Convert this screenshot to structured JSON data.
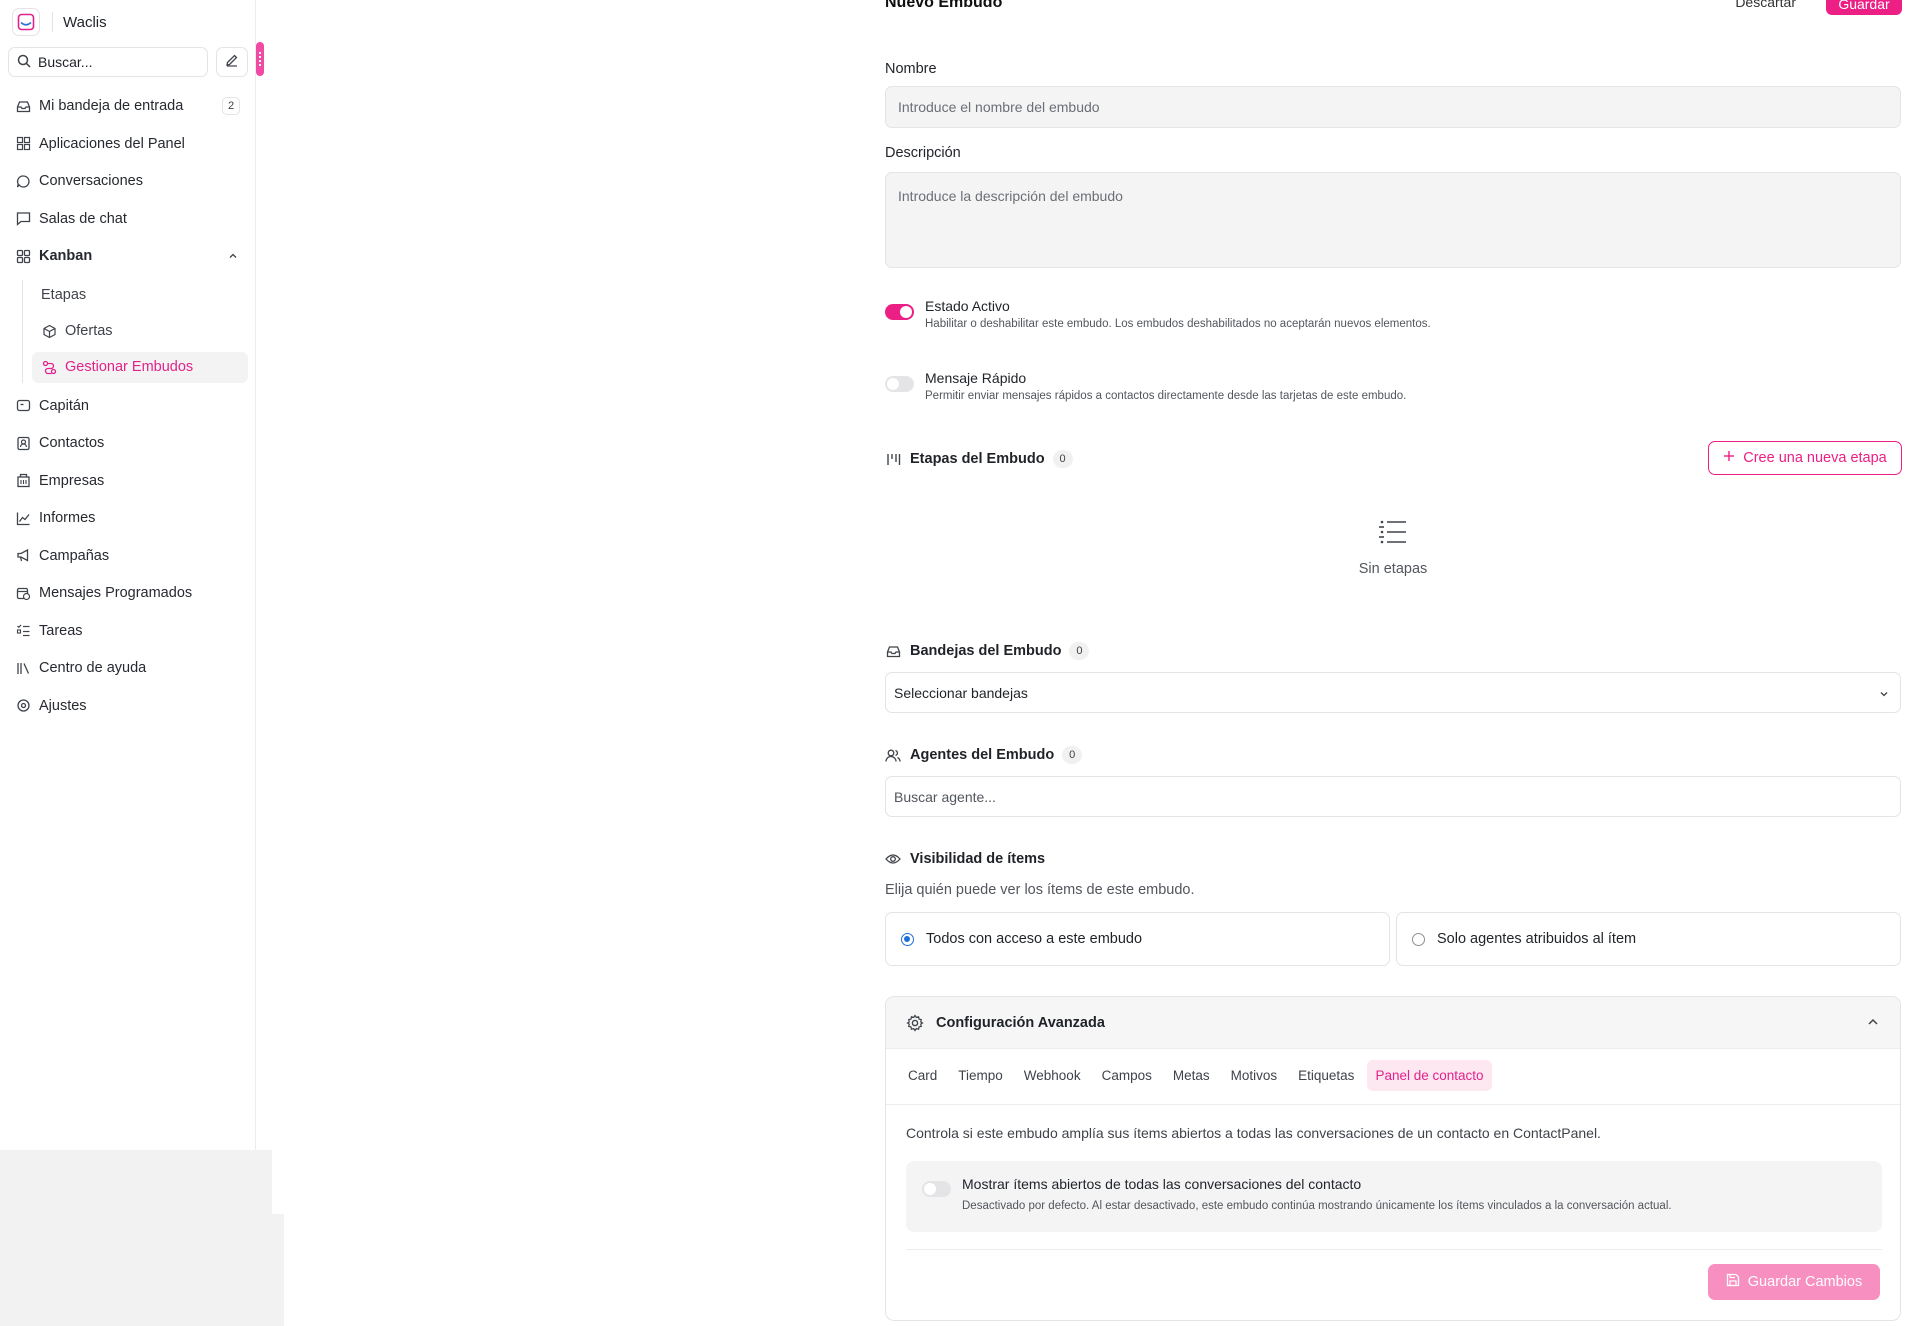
{
  "app": {
    "name": "Waclis"
  },
  "sidebar": {
    "search_placeholder": "Buscar...",
    "items": [
      {
        "label": "Mi bandeja de entrada",
        "icon": "inbox-icon",
        "badge": "2"
      },
      {
        "label": "Aplicaciones del Panel",
        "icon": "apps-grid-icon"
      },
      {
        "label": "Conversaciones",
        "icon": "chat-bubble-icon"
      },
      {
        "label": "Salas de chat",
        "icon": "message-square-icon"
      },
      {
        "label": "Kanban",
        "icon": "kanban-grid-icon",
        "expanded": true
      },
      {
        "label": "Capitán",
        "icon": "captain-icon"
      },
      {
        "label": "Contactos",
        "icon": "contact-card-icon"
      },
      {
        "label": "Empresas",
        "icon": "building-icon"
      },
      {
        "label": "Informes",
        "icon": "line-chart-icon"
      },
      {
        "label": "Campañas",
        "icon": "megaphone-icon"
      },
      {
        "label": "Mensajes Programados",
        "icon": "calendar-clock-icon"
      },
      {
        "label": "Tareas",
        "icon": "task-list-icon"
      },
      {
        "label": "Centro de ayuda",
        "icon": "library-icon"
      },
      {
        "label": "Ajustes",
        "icon": "settings-icon"
      }
    ],
    "kanban_sub": [
      {
        "label": "Etapas"
      },
      {
        "label": "Ofertas",
        "icon": "package-icon"
      },
      {
        "label": "Gestionar Embudos",
        "icon": "funnel-route-icon",
        "active": true
      }
    ]
  },
  "header": {
    "title": "Nuevo Embudo",
    "discard_label": "Descartar",
    "save_label": "Guardar"
  },
  "form": {
    "name_label": "Nombre",
    "name_placeholder": "Introduce el nombre del embudo",
    "desc_label": "Descripción",
    "desc_placeholder": "Introduce la descripción del embudo",
    "active": {
      "title": "Estado Activo",
      "desc": "Habilitar o deshabilitar este embudo. Los embudos deshabilitados no aceptarán nuevos elementos.",
      "on": true
    },
    "quick": {
      "title": "Mensaje Rápido",
      "desc": "Permitir enviar mensajes rápidos a contactos directamente desde las tarjetas de este embudo.",
      "on": false
    }
  },
  "stages": {
    "title": "Etapas del Embudo",
    "count": "0",
    "new_label": "Cree una nueva etapa",
    "empty_text": "Sin etapas"
  },
  "inboxes": {
    "title": "Bandejas del Embudo",
    "count": "0",
    "select_label": "Seleccionar bandejas"
  },
  "agents": {
    "title": "Agentes del Embudo",
    "count": "0",
    "search_placeholder": "Buscar agente..."
  },
  "visibility": {
    "title": "Visibilidad de ítems",
    "desc": "Elija quién puede ver los ítems de este embudo.",
    "options": [
      {
        "label": "Todos con acceso a este embudo",
        "selected": true
      },
      {
        "label": "Solo agentes atribuidos al ítem",
        "selected": false
      }
    ]
  },
  "advanced": {
    "title": "Configuración Avanzada",
    "tabs": [
      "Card",
      "Tiempo",
      "Webhook",
      "Campos",
      "Metas",
      "Motivos",
      "Etiquetas",
      "Panel de contacto"
    ],
    "active_tab": "Panel de contacto",
    "panel_desc": "Controla si este embudo amplía sus ítems abiertos a todas las conversaciones de un contacto en ContactPanel.",
    "option_title": "Mostrar ítems abiertos de todas las conversaciones del contacto",
    "option_desc": "Desactivado por defecto. Al estar desactivado, este embudo continúa mostrando únicamente los ítems vinculados a la conversación actual.",
    "option_on": false,
    "save_label": "Guardar Cambios"
  },
  "colors": {
    "accent": "#ec1f85",
    "accent_light": "#f78fc1",
    "radio": "#1e6fd9"
  }
}
